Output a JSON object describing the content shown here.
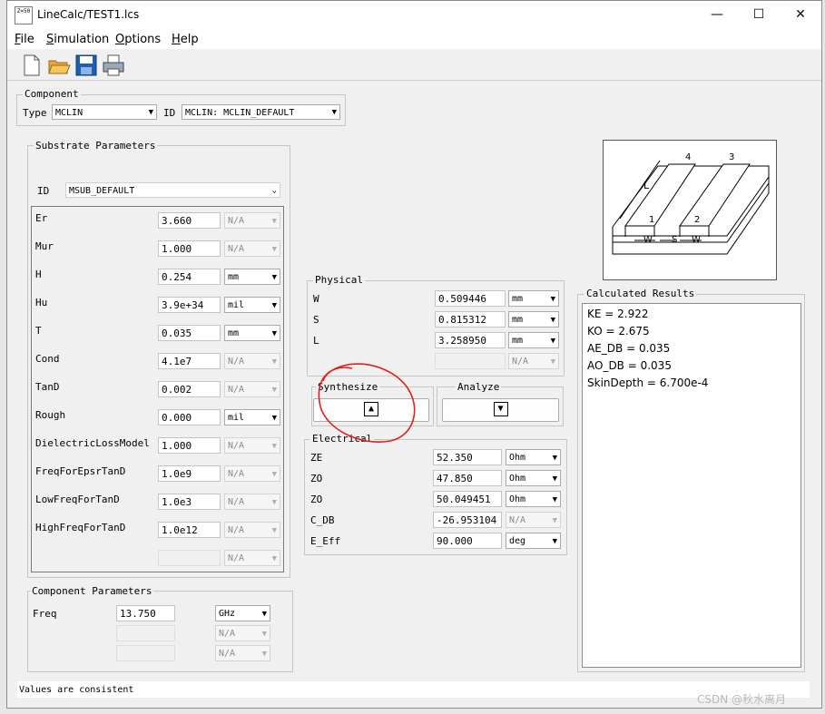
{
  "window": {
    "title": "LineCalc/TEST1.lcs",
    "app_icon_text": "Z=50"
  },
  "menu": [
    "File",
    "Simulation",
    "Options",
    "Help"
  ],
  "toolbar": [
    "new-file-icon",
    "open-folder-icon",
    "save-disk-icon",
    "print-icon"
  ],
  "component": {
    "legend": "Component",
    "type_label": "Type",
    "type_value": "MCLIN",
    "id_label": "ID",
    "id_value": "MCLIN: MCLIN_DEFAULT"
  },
  "substrate": {
    "legend": "Substrate Parameters",
    "id_label": "ID",
    "id_value": "MSUB_DEFAULT",
    "params": [
      {
        "name": "Er",
        "value": "3.660",
        "unit": "N/A"
      },
      {
        "name": "Mur",
        "value": "1.000",
        "unit": "N/A"
      },
      {
        "name": "H",
        "value": "0.254",
        "unit": "mm"
      },
      {
        "name": "Hu",
        "value": "3.9e+34",
        "unit": "mil"
      },
      {
        "name": "T",
        "value": "0.035",
        "unit": "mm"
      },
      {
        "name": "Cond",
        "value": "4.1e7",
        "unit": "N/A"
      },
      {
        "name": "TanD",
        "value": "0.002",
        "unit": "N/A"
      },
      {
        "name": "Rough",
        "value": "0.000",
        "unit": "mil"
      },
      {
        "name": "DielectricLossModel",
        "value": "1.000",
        "unit": "N/A"
      },
      {
        "name": "FreqForEpsrTanD",
        "value": "1.0e9",
        "unit": "N/A"
      },
      {
        "name": "LowFreqForTanD",
        "value": "1.0e3",
        "unit": "N/A"
      },
      {
        "name": "HighFreqForTanD",
        "value": "1.0e12",
        "unit": "N/A"
      },
      {
        "name": "",
        "value": "",
        "unit": "N/A"
      }
    ]
  },
  "component_params": {
    "legend": "Component Parameters",
    "rows": [
      {
        "name": "Freq",
        "value": "13.750",
        "unit": "GHz"
      },
      {
        "name": "",
        "value": "",
        "unit": "N/A"
      },
      {
        "name": "",
        "value": "",
        "unit": "N/A"
      }
    ]
  },
  "physical": {
    "legend": "Physical",
    "rows": [
      {
        "name": "W",
        "value": "0.509446",
        "unit": "mm"
      },
      {
        "name": "S",
        "value": "0.815312",
        "unit": "mm"
      },
      {
        "name": "L",
        "value": "3.258950",
        "unit": "mm"
      },
      {
        "name": "",
        "value": "",
        "unit": "N/A"
      }
    ]
  },
  "synthesize": {
    "label": "Synthesize",
    "arrow": "▲"
  },
  "analyze": {
    "label": "Analyze",
    "arrow": "▼"
  },
  "electrical": {
    "legend": "Electrical",
    "rows": [
      {
        "name": "ZE",
        "value": "52.350",
        "unit": "Ohm"
      },
      {
        "name": "ZO",
        "value": "47.850",
        "unit": "Ohm"
      },
      {
        "name": "ZO",
        "value": "50.049451",
        "unit": "Ohm"
      },
      {
        "name": "C_DB",
        "value": "-26.953104",
        "unit": "N/A"
      },
      {
        "name": "E_Eff",
        "value": "90.000",
        "unit": "deg"
      }
    ]
  },
  "diagram": {
    "labels": [
      "4",
      "3",
      "L",
      "1",
      "2",
      "W",
      "S",
      "W"
    ]
  },
  "results": {
    "legend": "Calculated Results",
    "lines": [
      "KE = 2.922",
      "KO = 2.675",
      "AE_DB = 0.035",
      "AO_DB = 0.035",
      "SkinDepth = 6.700e-4"
    ]
  },
  "status": "Values are consistent",
  "watermark": "CSDN @秋水离月",
  "colors": {
    "annotation_circle": "#e02020",
    "disabled_text": "#8a8a8a"
  }
}
